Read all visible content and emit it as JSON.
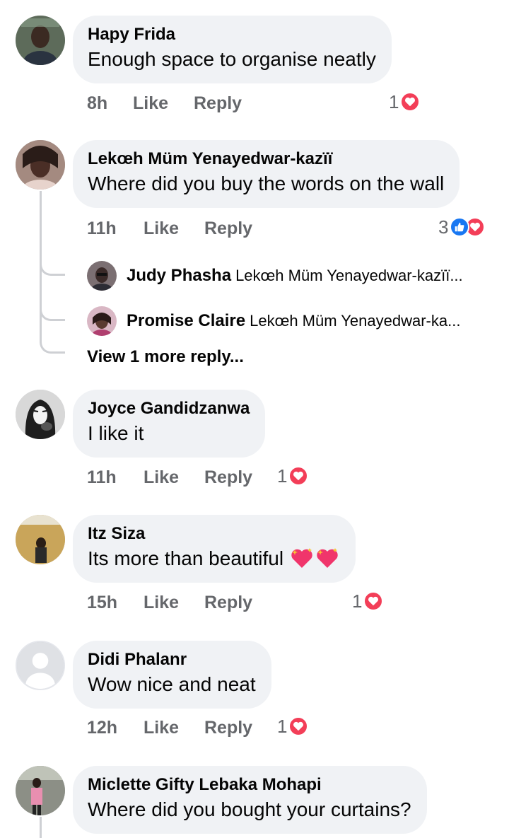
{
  "comments": [
    {
      "author": "Hapy Frida",
      "text": "Enough space to organise neatly",
      "time": "8h",
      "like_label": "Like",
      "reply_label": "Reply",
      "reaction_count": "1",
      "reaction_icons": [
        "love-icon"
      ]
    },
    {
      "author": "Lekœh Müm Yenayedwar-kazïï",
      "text": "Where did you buy the words on the wall",
      "time": "11h",
      "like_label": "Like",
      "reply_label": "Reply",
      "reaction_count": "3",
      "reaction_icons": [
        "like-icon",
        "love-icon"
      ],
      "replies": [
        {
          "name": "Judy Phasha",
          "text": "Lekœh Müm Yenayedwar-kazïï..."
        },
        {
          "name": "Promise Claire",
          "text": "Lekœh Müm Yenayedwar-ka..."
        }
      ],
      "view_more": "View 1 more reply..."
    },
    {
      "author": "Joyce Gandidzanwa",
      "text": "I like it",
      "time": "11h",
      "like_label": "Like",
      "reply_label": "Reply",
      "reaction_count": "1",
      "reaction_icons": [
        "love-icon"
      ]
    },
    {
      "author": "Itz Siza",
      "text": "Its more than beautiful",
      "text_emoji": [
        "sparkling-heart-icon",
        "sparkling-heart-icon"
      ],
      "time": "15h",
      "like_label": "Like",
      "reply_label": "Reply",
      "reaction_count": "1",
      "reaction_icons": [
        "love-icon"
      ]
    },
    {
      "author": "Didi Phalanr",
      "text": "Wow nice and neat",
      "time": "12h",
      "like_label": "Like",
      "reply_label": "Reply",
      "reaction_count": "1",
      "reaction_icons": [
        "love-icon"
      ]
    },
    {
      "author": "Miclette Gifty Lebaka Mohapi",
      "text": "Where did you bought your curtains?"
    }
  ],
  "colors": {
    "bubble": "#f0f2f5",
    "meta_text": "#65676b",
    "love": "#f33e58",
    "like": "#1877f2",
    "thread_line": "#ced0d4"
  }
}
